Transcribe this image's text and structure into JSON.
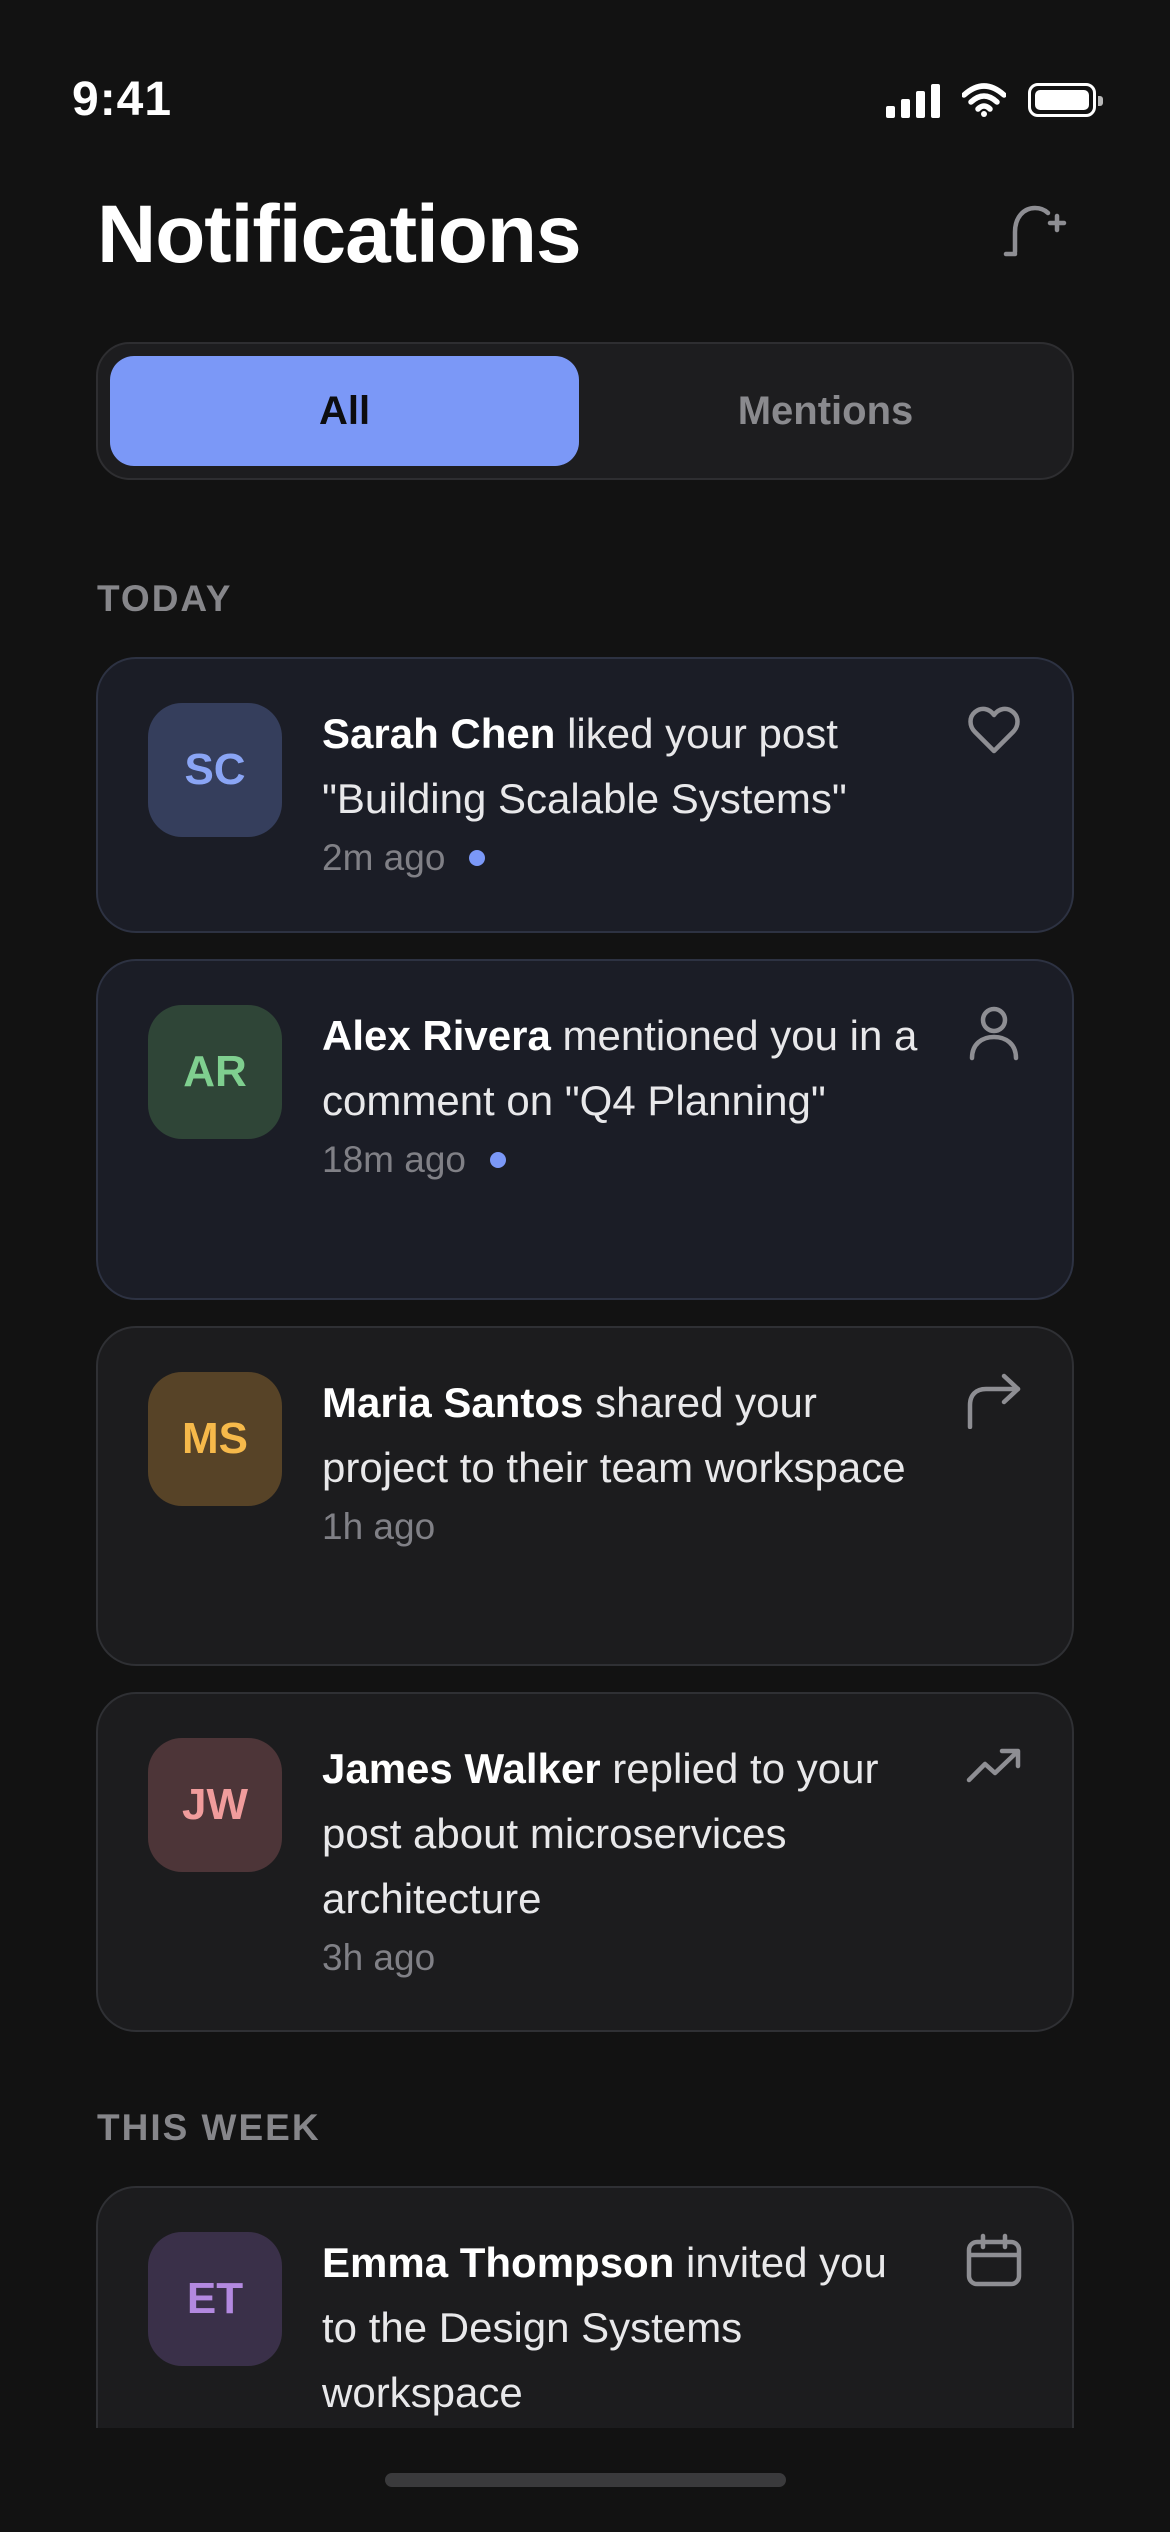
{
  "status_bar": {
    "time": "9:41"
  },
  "header": {
    "title": "Notifications",
    "action_icon": "bell-plus-icon"
  },
  "tabs": [
    {
      "label": "All",
      "active": true
    },
    {
      "label": "Mentions",
      "active": false
    }
  ],
  "sections": {
    "today": "TODAY",
    "this_week": "THIS WEEK"
  },
  "colors": {
    "accent": "#7b98f7",
    "background": "#121212",
    "card": "#1c1c1e"
  },
  "notifications": [
    {
      "initials": "SC",
      "name": "Sarah Chen",
      "action": " liked your post \"Building Scalable Systems\"",
      "time": "2m ago",
      "unread": true,
      "icon": "heart-icon",
      "avatar_bg": "#353e5c",
      "avatar_fg": "#8aa5f5"
    },
    {
      "initials": "AR",
      "name": "Alex Rivera",
      "action": " mentioned you in a comment on \"Q4 Planning\"",
      "time": "18m ago",
      "unread": true,
      "icon": "user-icon",
      "avatar_bg": "#2f4537",
      "avatar_fg": "#7fcf8f"
    },
    {
      "initials": "MS",
      "name": "Maria Santos",
      "action": " shared your project to their team workspace",
      "time": "1h ago",
      "unread": false,
      "icon": "share-arrow-icon",
      "avatar_bg": "#574327",
      "avatar_fg": "#f6b94a"
    },
    {
      "initials": "JW",
      "name": "James Walker",
      "action": " replied to your post about microservices architecture",
      "time": "3h ago",
      "unread": false,
      "icon": "trending-up-icon",
      "avatar_bg": "#4d3538",
      "avatar_fg": "#f09c9c"
    },
    {
      "initials": "ET",
      "name": "Emma Thompson",
      "action": " invited you to the Design Systems workspace",
      "time": "",
      "unread": false,
      "icon": "calendar-icon",
      "avatar_bg": "#3a3049",
      "avatar_fg": "#b389e0"
    }
  ]
}
